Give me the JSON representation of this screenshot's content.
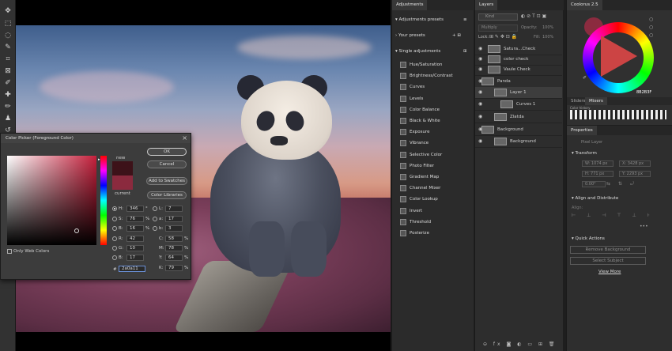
{
  "colors": {
    "foreground": "#2a0a11",
    "new_color": "#3d1219",
    "current_color": "#8b2a3e",
    "panel": "#2b2b2b",
    "accent": "#c51f3b"
  },
  "toolbar": {
    "icons": [
      "move-icon",
      "marquee-icon",
      "lasso-icon",
      "quick-select-icon",
      "crop-icon",
      "frame-icon",
      "eyedropper-icon",
      "healing-icon",
      "brush-icon",
      "stamp-icon",
      "history-brush-icon",
      "eraser-icon"
    ]
  },
  "picker": {
    "title": "Color Picker (Foreground Color)",
    "new_label": "new",
    "current_label": "current",
    "ok": "OK",
    "cancel": "Cancel",
    "add_swatches": "Add to Swatches",
    "color_libraries": "Color Libraries",
    "only_web": "Only Web Colors",
    "fields": {
      "h": {
        "label": "H:",
        "value": "346",
        "unit": "°"
      },
      "s": {
        "label": "S:",
        "value": "76",
        "unit": "%"
      },
      "b": {
        "label": "B:",
        "value": "16",
        "unit": "%"
      },
      "r": {
        "label": "R:",
        "value": "42"
      },
      "g": {
        "label": "G:",
        "value": "10"
      },
      "bb": {
        "label": "B:",
        "value": "17"
      },
      "l": {
        "label": "L:",
        "value": "7"
      },
      "a": {
        "label": "a:",
        "value": "17"
      },
      "lb": {
        "label": "b:",
        "value": "3"
      },
      "c": {
        "label": "C:",
        "value": "58",
        "unit": "%"
      },
      "m": {
        "label": "M:",
        "value": "78",
        "unit": "%"
      },
      "y": {
        "label": "Y:",
        "value": "64",
        "unit": "%"
      },
      "k": {
        "label": "K:",
        "value": "79",
        "unit": "%"
      }
    },
    "hex_label": "#",
    "hex": "2a0a11"
  },
  "adjustments": {
    "tab": "Adjustments",
    "presets": "Adjustments presets",
    "your_presets": "Your presets",
    "single": "Single adjustments",
    "items": [
      "Hue/Saturation",
      "Brightness/Contrast",
      "Curves",
      "Levels",
      "Color Balance",
      "Black & White",
      "Exposure",
      "Vibrance",
      "Selective Color",
      "Photo Filter",
      "Gradient Map",
      "Channel Mixer",
      "Color Lookup",
      "Invert",
      "Threshold",
      "Posterize"
    ]
  },
  "layers": {
    "tab": "Layers",
    "search": "Kind",
    "blend": "Multiply",
    "opacity_label": "Opacity:",
    "opacity": "100%",
    "lock_label": "Lock:",
    "fill_label": "Fill:",
    "fill": "100%",
    "rows": [
      {
        "name": "Satura...Check"
      },
      {
        "name": "color check"
      },
      {
        "name": "Vaule Check"
      },
      {
        "name": "Panda"
      },
      {
        "name": "Layer 1"
      },
      {
        "name": "Curves 1"
      },
      {
        "name": "Zlatda"
      },
      {
        "name": "Background"
      },
      {
        "name": "Background"
      }
    ]
  },
  "coolorus": {
    "title": "Coolorus 2.5",
    "hex": "8B2B3F",
    "tabs": [
      "Sliders",
      "Mixers"
    ],
    "color_history_label": "Color history"
  },
  "properties": {
    "tab": "Properties",
    "pixel_layer": "Pixel Layer",
    "transform": "Transform",
    "w": "W: 1074 px",
    "h": "H: 771 px",
    "x": "X: 3428 px",
    "y": "Y: 2293 px",
    "angle": "0.00°",
    "align": "Align and Distribute",
    "align_sub": "Align:",
    "quick_actions": "Quick Actions",
    "remove_bg": "Remove Background",
    "select_subject": "Select Subject",
    "view_more": "View More"
  }
}
